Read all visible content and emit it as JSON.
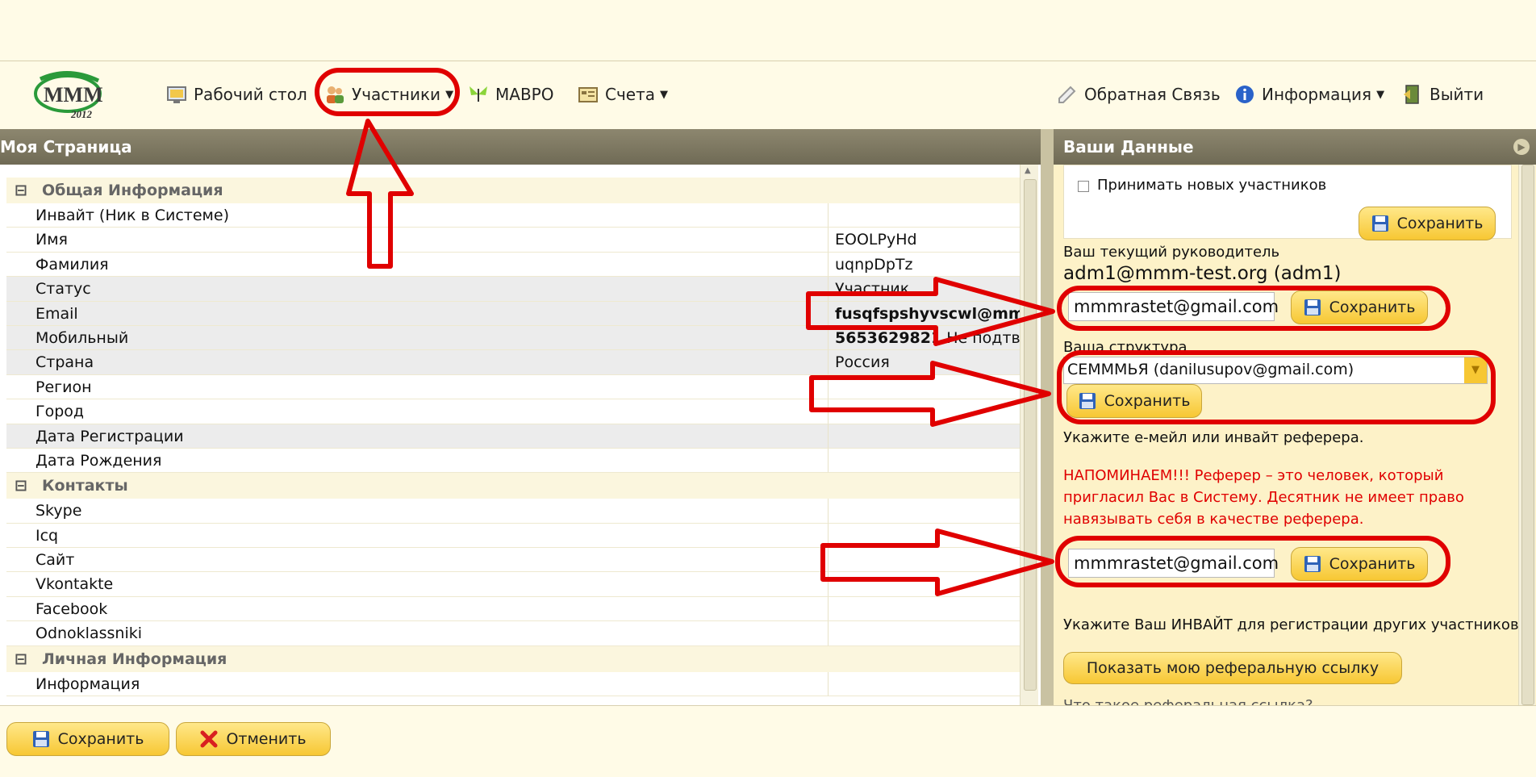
{
  "nav": {
    "logo_text": "МММ",
    "logo_year": "2012",
    "desktop": "Рабочий стол",
    "participants": "Участники",
    "mavro": "МАВРО",
    "accounts": "Счета",
    "feedback": "Обратная Связь",
    "info": "Информация",
    "logout": "Выйти"
  },
  "left_panel": {
    "title": "Моя Страница",
    "groups": [
      {
        "label": "Общая Информация",
        "rows": [
          {
            "name": "Инвайт (Ник в Системе)",
            "value": ""
          },
          {
            "name": "Имя",
            "value": "EOOLPyHd"
          },
          {
            "name": "Фамилия",
            "value": "uqnpDpTz"
          },
          {
            "name": "Статус",
            "value": "Участник"
          },
          {
            "name": "Email",
            "value": "fusqfspshyvscwl@mm"
          },
          {
            "name": "Мобильный",
            "value": "5653629821",
            "value_note": " Не подтвер"
          },
          {
            "name": "Страна",
            "value": "Россия"
          },
          {
            "name": "Регион",
            "value": ""
          },
          {
            "name": "Город",
            "value": ""
          },
          {
            "name": "Дата Регистрации",
            "value": ""
          },
          {
            "name": "Дата Рождения",
            "value": ""
          }
        ]
      },
      {
        "label": "Контакты",
        "rows": [
          {
            "name": "Skype",
            "value": ""
          },
          {
            "name": "Icq",
            "value": ""
          },
          {
            "name": "Сайт",
            "value": ""
          },
          {
            "name": "Vkontakte",
            "value": ""
          },
          {
            "name": "Facebook",
            "value": ""
          },
          {
            "name": "Odnoklassniki",
            "value": ""
          }
        ]
      },
      {
        "label": "Личная Информация",
        "rows": [
          {
            "name": "Информация",
            "value": ""
          }
        ]
      }
    ]
  },
  "right_panel": {
    "title": "Ваши Данные",
    "accept_new": "Принимать новых участников",
    "save": "Сохранить",
    "current_leader_label": "Ваш текущий руководитель",
    "current_leader_value": "adm1@mmm-test.org (adm1)",
    "leader_input": "mmmrastet@gmail.com",
    "structure_label": "Ваша структура",
    "structure_value": "СЕМММЬЯ (danilusupov@gmail.com)",
    "referrer_hint": "Укажите е-мейл или инвайт реферера.",
    "reminder": "НАПОМИНАЕМ!!! Реферер – это человек, который пригласил Вас в Систему. Десятник не имеет право навязывать себя в качестве реферера.",
    "referrer_input": "mmmrastet@gmail.com",
    "invite_hint": "Укажите Ваш ИНВАЙТ для регистрации других участников",
    "show_link": "Показать мою реферальную ссылку",
    "cut_text": "Что такое реферальная ссылка?"
  },
  "bottom": {
    "save": "Сохранить",
    "cancel": "Отменить"
  },
  "colors": {
    "annotation": "#e00000",
    "button": "#f7c733",
    "header": "#7d7862"
  },
  "icons": [
    "desktop-icon",
    "participants-icon",
    "butterfly-icon",
    "accounts-icon",
    "feedback-icon",
    "info-icon",
    "exit-icon",
    "disk-icon",
    "cancel-icon",
    "collapse-icon"
  ]
}
